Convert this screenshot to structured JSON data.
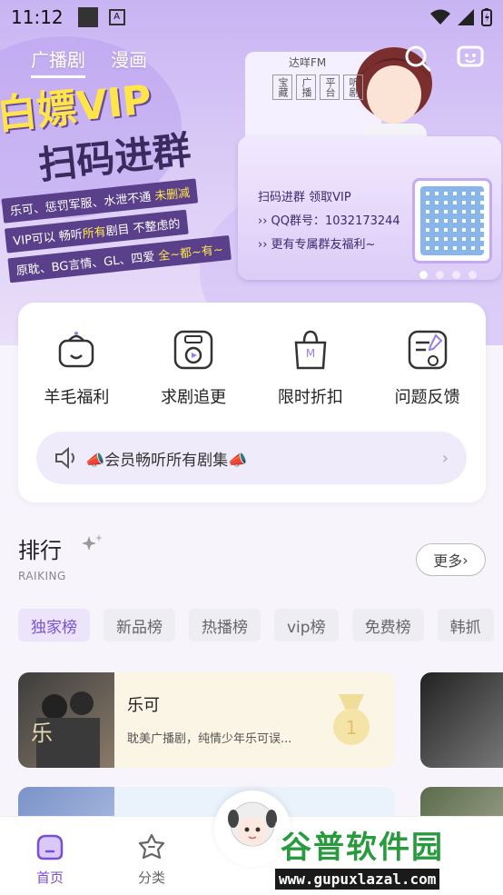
{
  "status_bar": {
    "time": "11:12",
    "notif_badge": "A"
  },
  "top_tabs": [
    {
      "label": "广播剧",
      "active": true
    },
    {
      "label": "漫画",
      "active": false
    }
  ],
  "banner": {
    "title_line1": "白嫖VIP",
    "title_line2": "扫码进群",
    "lines": [
      {
        "text": "乐可、惩罚军服、水泄不通 ",
        "highlight": "未删减"
      },
      {
        "text": "VIP可以 畅听",
        "highlight": "所有",
        "text2": "剧目 不整虑的"
      },
      {
        "text": "原耽、BG言情、GL、四爱 ",
        "highlight": "全~都~有~"
      }
    ],
    "fm_label": "达咩FM",
    "vertical_text": [
      "宝藏",
      "广播",
      "平台",
      "听剧"
    ],
    "info_lines": [
      "扫码进群 领取VIP",
      "›› QQ群号：1032173244",
      "›› 更有专属群友福利~"
    ],
    "side_badge": "达咩FM",
    "page_dots": 4,
    "active_dot": 0
  },
  "shortcuts": [
    {
      "label": "羊毛福利",
      "icon": "gift-box-icon"
    },
    {
      "label": "求剧追更",
      "icon": "radio-fm-icon"
    },
    {
      "label": "限时折扣",
      "icon": "shopping-bag-icon"
    },
    {
      "label": "问题反馈",
      "icon": "feedback-note-icon"
    }
  ],
  "vip_bar": {
    "text": "📣会员畅听所有剧集📣"
  },
  "ranking": {
    "title": "排行",
    "subtitle": "RAIKING",
    "more_label": "更多",
    "chips": [
      {
        "label": "独家榜",
        "active": true
      },
      {
        "label": "新品榜",
        "active": false
      },
      {
        "label": "热播榜",
        "active": false
      },
      {
        "label": "vip榜",
        "active": false
      },
      {
        "label": "免费榜",
        "active": false
      },
      {
        "label": "韩抓",
        "active": false
      }
    ],
    "items": [
      {
        "title": "乐可",
        "desc": "耽美广播剧，纯情少年乐可误...",
        "rank": "1"
      }
    ]
  },
  "bottom_nav": [
    {
      "label": "首页",
      "active": true
    },
    {
      "label": "分类",
      "active": false
    }
  ],
  "watermark": {
    "title": "谷普软件园",
    "url": "www.gupuxlazal.com"
  },
  "colors": {
    "accent": "#7a4fd6",
    "banner_bg": "#c9b4f3",
    "watermark_green": "#2a9a3f"
  }
}
